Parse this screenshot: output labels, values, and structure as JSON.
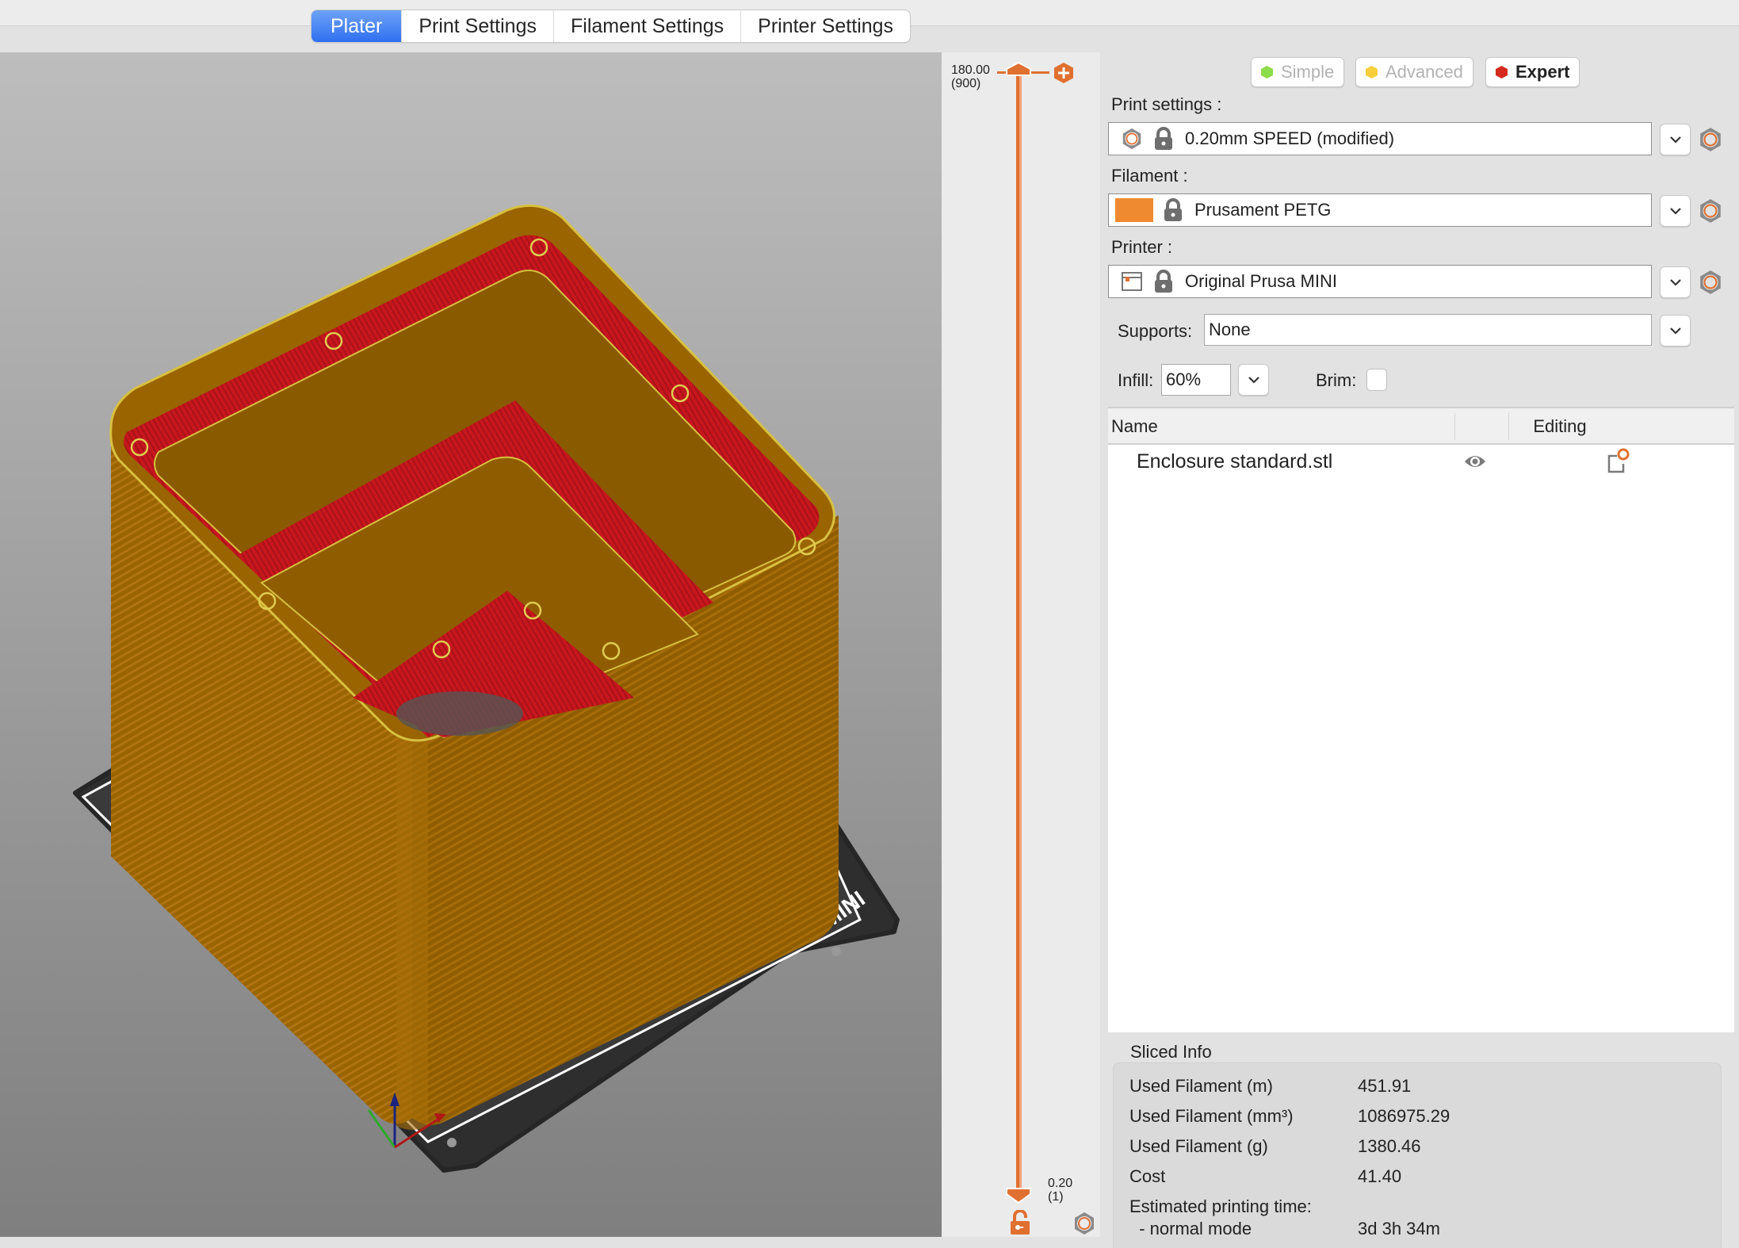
{
  "tabs": [
    {
      "label": "Plater",
      "active": true
    },
    {
      "label": "Print Settings",
      "active": false
    },
    {
      "label": "Filament Settings",
      "active": false
    },
    {
      "label": "Printer Settings",
      "active": false
    }
  ],
  "viewport": {
    "model_name": "Enclosure standard.stl",
    "bed_label": "MINI",
    "colors": {
      "perimeter": "#9a6400",
      "top_solid": "#c8161d",
      "bed": "#333333"
    }
  },
  "layer_slider": {
    "top_height": "180.00",
    "top_layer": "(900)",
    "bottom_height": "0.20",
    "bottom_layer": "(1)",
    "accent": "#e07030"
  },
  "modes": [
    {
      "label": "Simple",
      "color": "#8ddc4a",
      "active": false
    },
    {
      "label": "Advanced",
      "color": "#f6cf3a",
      "active": false
    },
    {
      "label": "Expert",
      "color": "#d42a1f",
      "active": true
    }
  ],
  "presets": {
    "print_label": "Print settings :",
    "print_value": "0.20mm SPEED (modified)",
    "filament_label": "Filament :",
    "filament_value": "Prusament PETG",
    "filament_color": "#f08a30",
    "printer_label": "Printer :",
    "printer_value": "Original Prusa MINI"
  },
  "options": {
    "supports_label": "Supports:",
    "supports_value": "None",
    "infill_label": "Infill:",
    "infill_value": "60%",
    "brim_label": "Brim:",
    "brim_checked": false
  },
  "object_list": {
    "col_name": "Name",
    "col_editing": "Editing",
    "rows": [
      {
        "name": "Enclosure standard.stl",
        "visible": true
      }
    ]
  },
  "sliced_info": {
    "title": "Sliced Info",
    "rows": [
      {
        "label": "Used Filament (m)",
        "value": "451.91"
      },
      {
        "label": "Used Filament (mm³)",
        "value": "1086975.29"
      },
      {
        "label": "Used Filament (g)",
        "value": "1380.46"
      },
      {
        "label": "Cost",
        "value": "41.40"
      },
      {
        "label": "Estimated printing time:",
        "value": ""
      },
      {
        "label": "  - normal mode",
        "value": "3d 3h 34m"
      }
    ]
  }
}
